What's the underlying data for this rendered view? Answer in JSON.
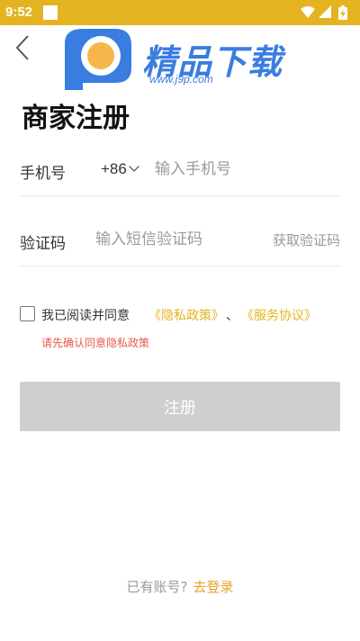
{
  "status_bar": {
    "time": "9:52",
    "color": "#e4b322",
    "icons": [
      "square-icon",
      "wifi-icon",
      "signal-icon",
      "battery-charging-icon"
    ]
  },
  "header": {
    "back_icon": "chevron-left-icon",
    "logo": {
      "name": "精品下载",
      "url": "www.j9p.com",
      "brand_color": "#3a7de0",
      "accent_color": "#f6b64a"
    }
  },
  "page": {
    "title": "商家注册"
  },
  "form": {
    "phone": {
      "label": "手机号",
      "country_code": "+86",
      "placeholder": "输入手机号",
      "value": ""
    },
    "code": {
      "label": "验证码",
      "placeholder": "输入短信验证码",
      "value": "",
      "get_code": "获取验证码"
    },
    "agreement": {
      "checked": false,
      "text": "我已阅读并同意",
      "privacy": "《隐私政策》",
      "separator": "、",
      "service": "《服务协议》",
      "link_color": "#e5b51f",
      "warning": "请先确认同意隐私政策",
      "warning_color": "#e85a4a"
    },
    "submit_label": "注册",
    "submit_color": "#cfcfcf"
  },
  "footer": {
    "question": "已有账号?",
    "login_link": "去登录",
    "link_color": "#e5a21f"
  }
}
